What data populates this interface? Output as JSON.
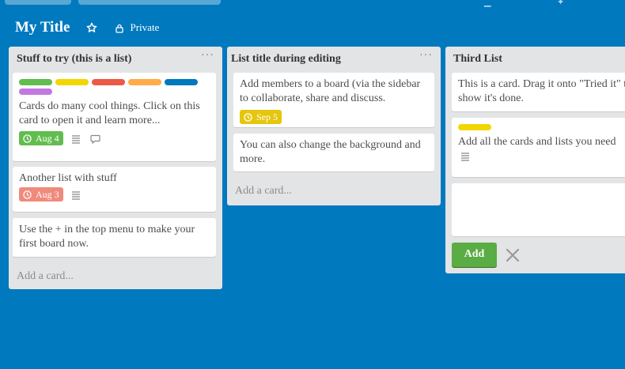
{
  "board": {
    "title": "My Title",
    "visibility": "Private"
  },
  "colors": {
    "background": "#0079bf",
    "green": "#61bd4f",
    "yellow": "#f2d600",
    "red": "#eb5a46",
    "orange": "#ffab4a",
    "blue": "#0079bf",
    "purple": "#c377e0"
  },
  "lists": [
    {
      "title": "Stuff to try (this is a list)",
      "menu": "···",
      "add_card": "Add a card...",
      "cards": [
        {
          "labels": [
            "green",
            "yellow",
            "red",
            "orange",
            "blue",
            "purple"
          ],
          "text": "Cards do many cool things. Click on this card to open it and learn more...",
          "due": "Aug 4",
          "icons": [
            "description-icon",
            "comment-icon"
          ]
        },
        {
          "text": "Another list with stuff",
          "due": "Aug 3",
          "icons": [
            "description-icon"
          ]
        },
        {
          "text": "Use the + in the top menu to make your first board now."
        }
      ]
    },
    {
      "title": "List title during editing",
      "menu": "···",
      "add_card": "Add a card...",
      "cards": [
        {
          "text": "Add members to a board (via the sidebar to collaborate, share and discuss.",
          "due": "Sep 5"
        },
        {
          "text": "You can also change the background and more."
        }
      ]
    },
    {
      "title": "Third List",
      "cards": [
        {
          "text": "This is a card. Drag it onto \"Tried it\" to show it's done."
        },
        {
          "labels": [
            "yellow"
          ],
          "text": "Add all the cards and lists you need",
          "icons": [
            "description-icon"
          ]
        }
      ],
      "composer": {
        "value": "",
        "add_label": "Add"
      }
    }
  ]
}
